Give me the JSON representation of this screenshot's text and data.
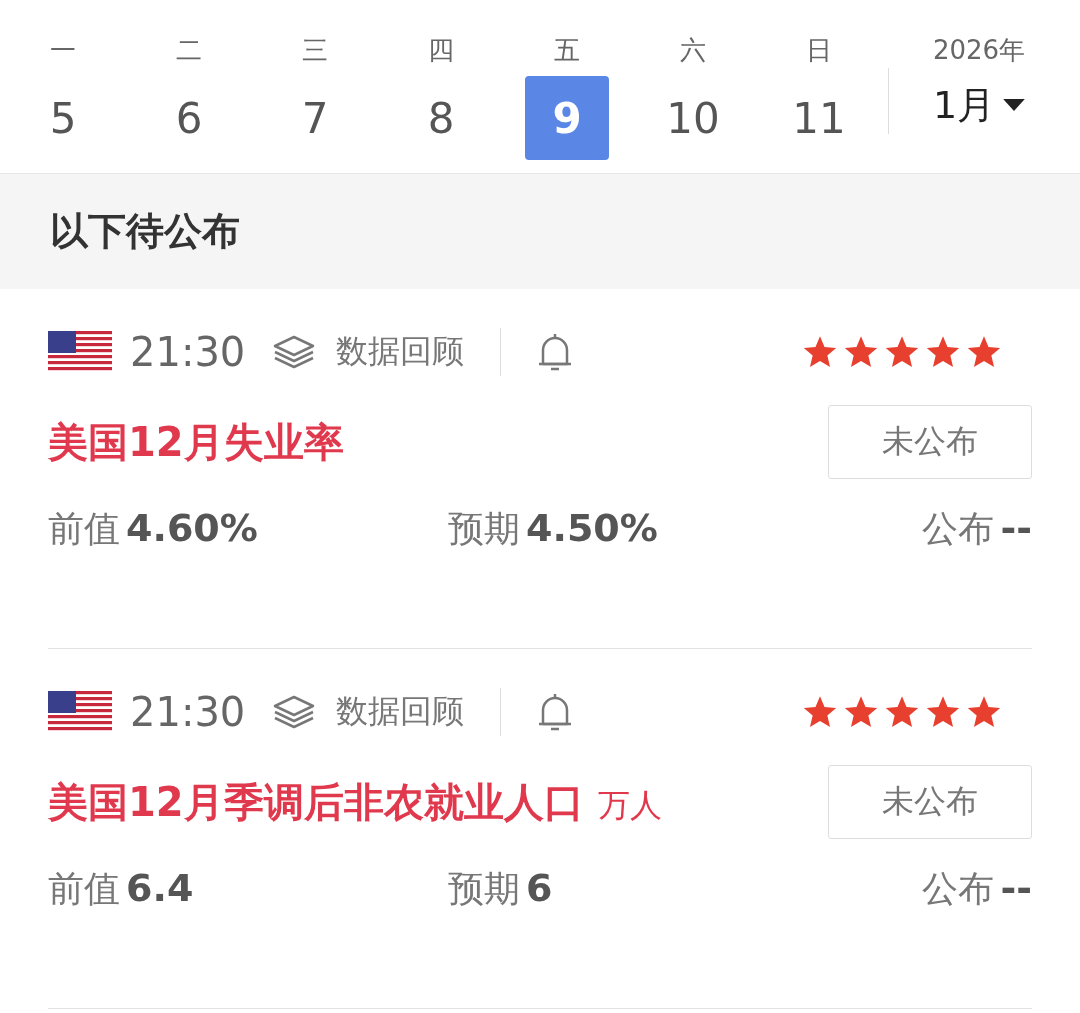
{
  "week": {
    "days": [
      {
        "weekday": "一",
        "date": "5",
        "selected": false
      },
      {
        "weekday": "二",
        "date": "6",
        "selected": false
      },
      {
        "weekday": "三",
        "date": "7",
        "selected": false
      },
      {
        "weekday": "四",
        "date": "8",
        "selected": false
      },
      {
        "weekday": "五",
        "date": "9",
        "selected": true
      },
      {
        "weekday": "六",
        "date": "10",
        "selected": false
      },
      {
        "weekday": "日",
        "date": "11",
        "selected": false
      }
    ],
    "year": "2026年",
    "month": "1月"
  },
  "section_title": "以下待公布",
  "events": [
    {
      "time": "21:30",
      "review_label": "数据回顾",
      "stars": 5,
      "title": "美国12月失业率",
      "status": "未公布",
      "previous_label": "前值",
      "previous": "4.60%",
      "forecast_label": "预期",
      "forecast": "4.50%",
      "actual_label": "公布",
      "actual": "--"
    },
    {
      "time": "21:30",
      "review_label": "数据回顾",
      "stars": 5,
      "title": "美国12月季调后非农就业人口",
      "unit": "万人",
      "status": "未公布",
      "previous_label": "前值",
      "previous": "6.4",
      "forecast_label": "预期",
      "forecast": "6",
      "actual_label": "公布",
      "actual": "--"
    }
  ]
}
